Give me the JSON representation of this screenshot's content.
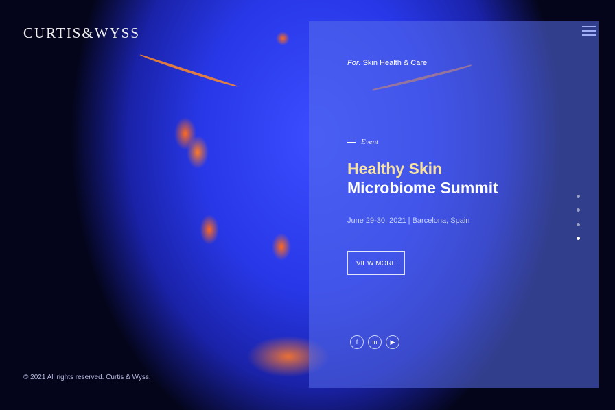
{
  "header": {
    "brand": "CURTIS&WYSS",
    "menu_icon": "hamburger-menu-icon"
  },
  "slide": {
    "for_label": "For:",
    "for_value": "Skin Health & Care",
    "category": "Event",
    "title_line1": "Healthy Skin",
    "title_line2": "Microbiome Summit",
    "date_location": "June 29-30, 2021 | Barcelona, Spain",
    "cta_label": "VIEW MORE"
  },
  "social": [
    {
      "icon": "facebook-icon",
      "glyph": "f"
    },
    {
      "icon": "linkedin-icon",
      "glyph": "in"
    },
    {
      "icon": "youtube-icon",
      "glyph": "▶"
    }
  ],
  "pagination": {
    "count": 4,
    "active_index": 3
  },
  "footer": {
    "copyright": "© 2021 All rights reserved. Curtis & Wyss."
  },
  "colors": {
    "title_accent": "#f8e2a0",
    "panel": "rgba(88,110,235,0.55)"
  }
}
